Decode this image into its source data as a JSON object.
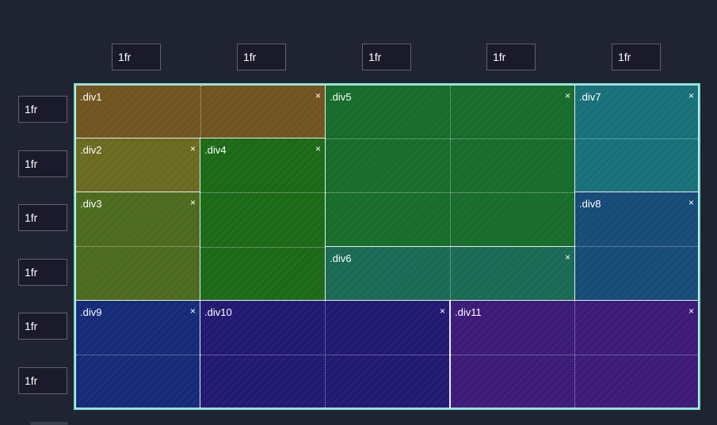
{
  "columns": [
    "1fr",
    "1fr",
    "1fr",
    "1fr",
    "1fr"
  ],
  "rows": [
    "1fr",
    "1fr",
    "1fr",
    "1fr",
    "1fr",
    "1fr"
  ],
  "close_glyph": "×",
  "areas": [
    {
      "label": ".div1",
      "color": "#705520"
    },
    {
      "label": ".div2",
      "color": "#6a6a20"
    },
    {
      "label": ".div3",
      "color": "#4c6b1e"
    },
    {
      "label": ".div4",
      "color": "#1c6a18"
    },
    {
      "label": ".div5",
      "color": "#186c2c"
    },
    {
      "label": ".div6",
      "color": "#1a6a55"
    },
    {
      "label": ".div7",
      "color": "#18717a"
    },
    {
      "label": ".div8",
      "color": "#174b78"
    },
    {
      "label": ".div9",
      "color": "#162b78"
    },
    {
      "label": ".div10",
      "color": "#221a72"
    },
    {
      "label": ".div11",
      "color": "#3d1b78"
    }
  ]
}
